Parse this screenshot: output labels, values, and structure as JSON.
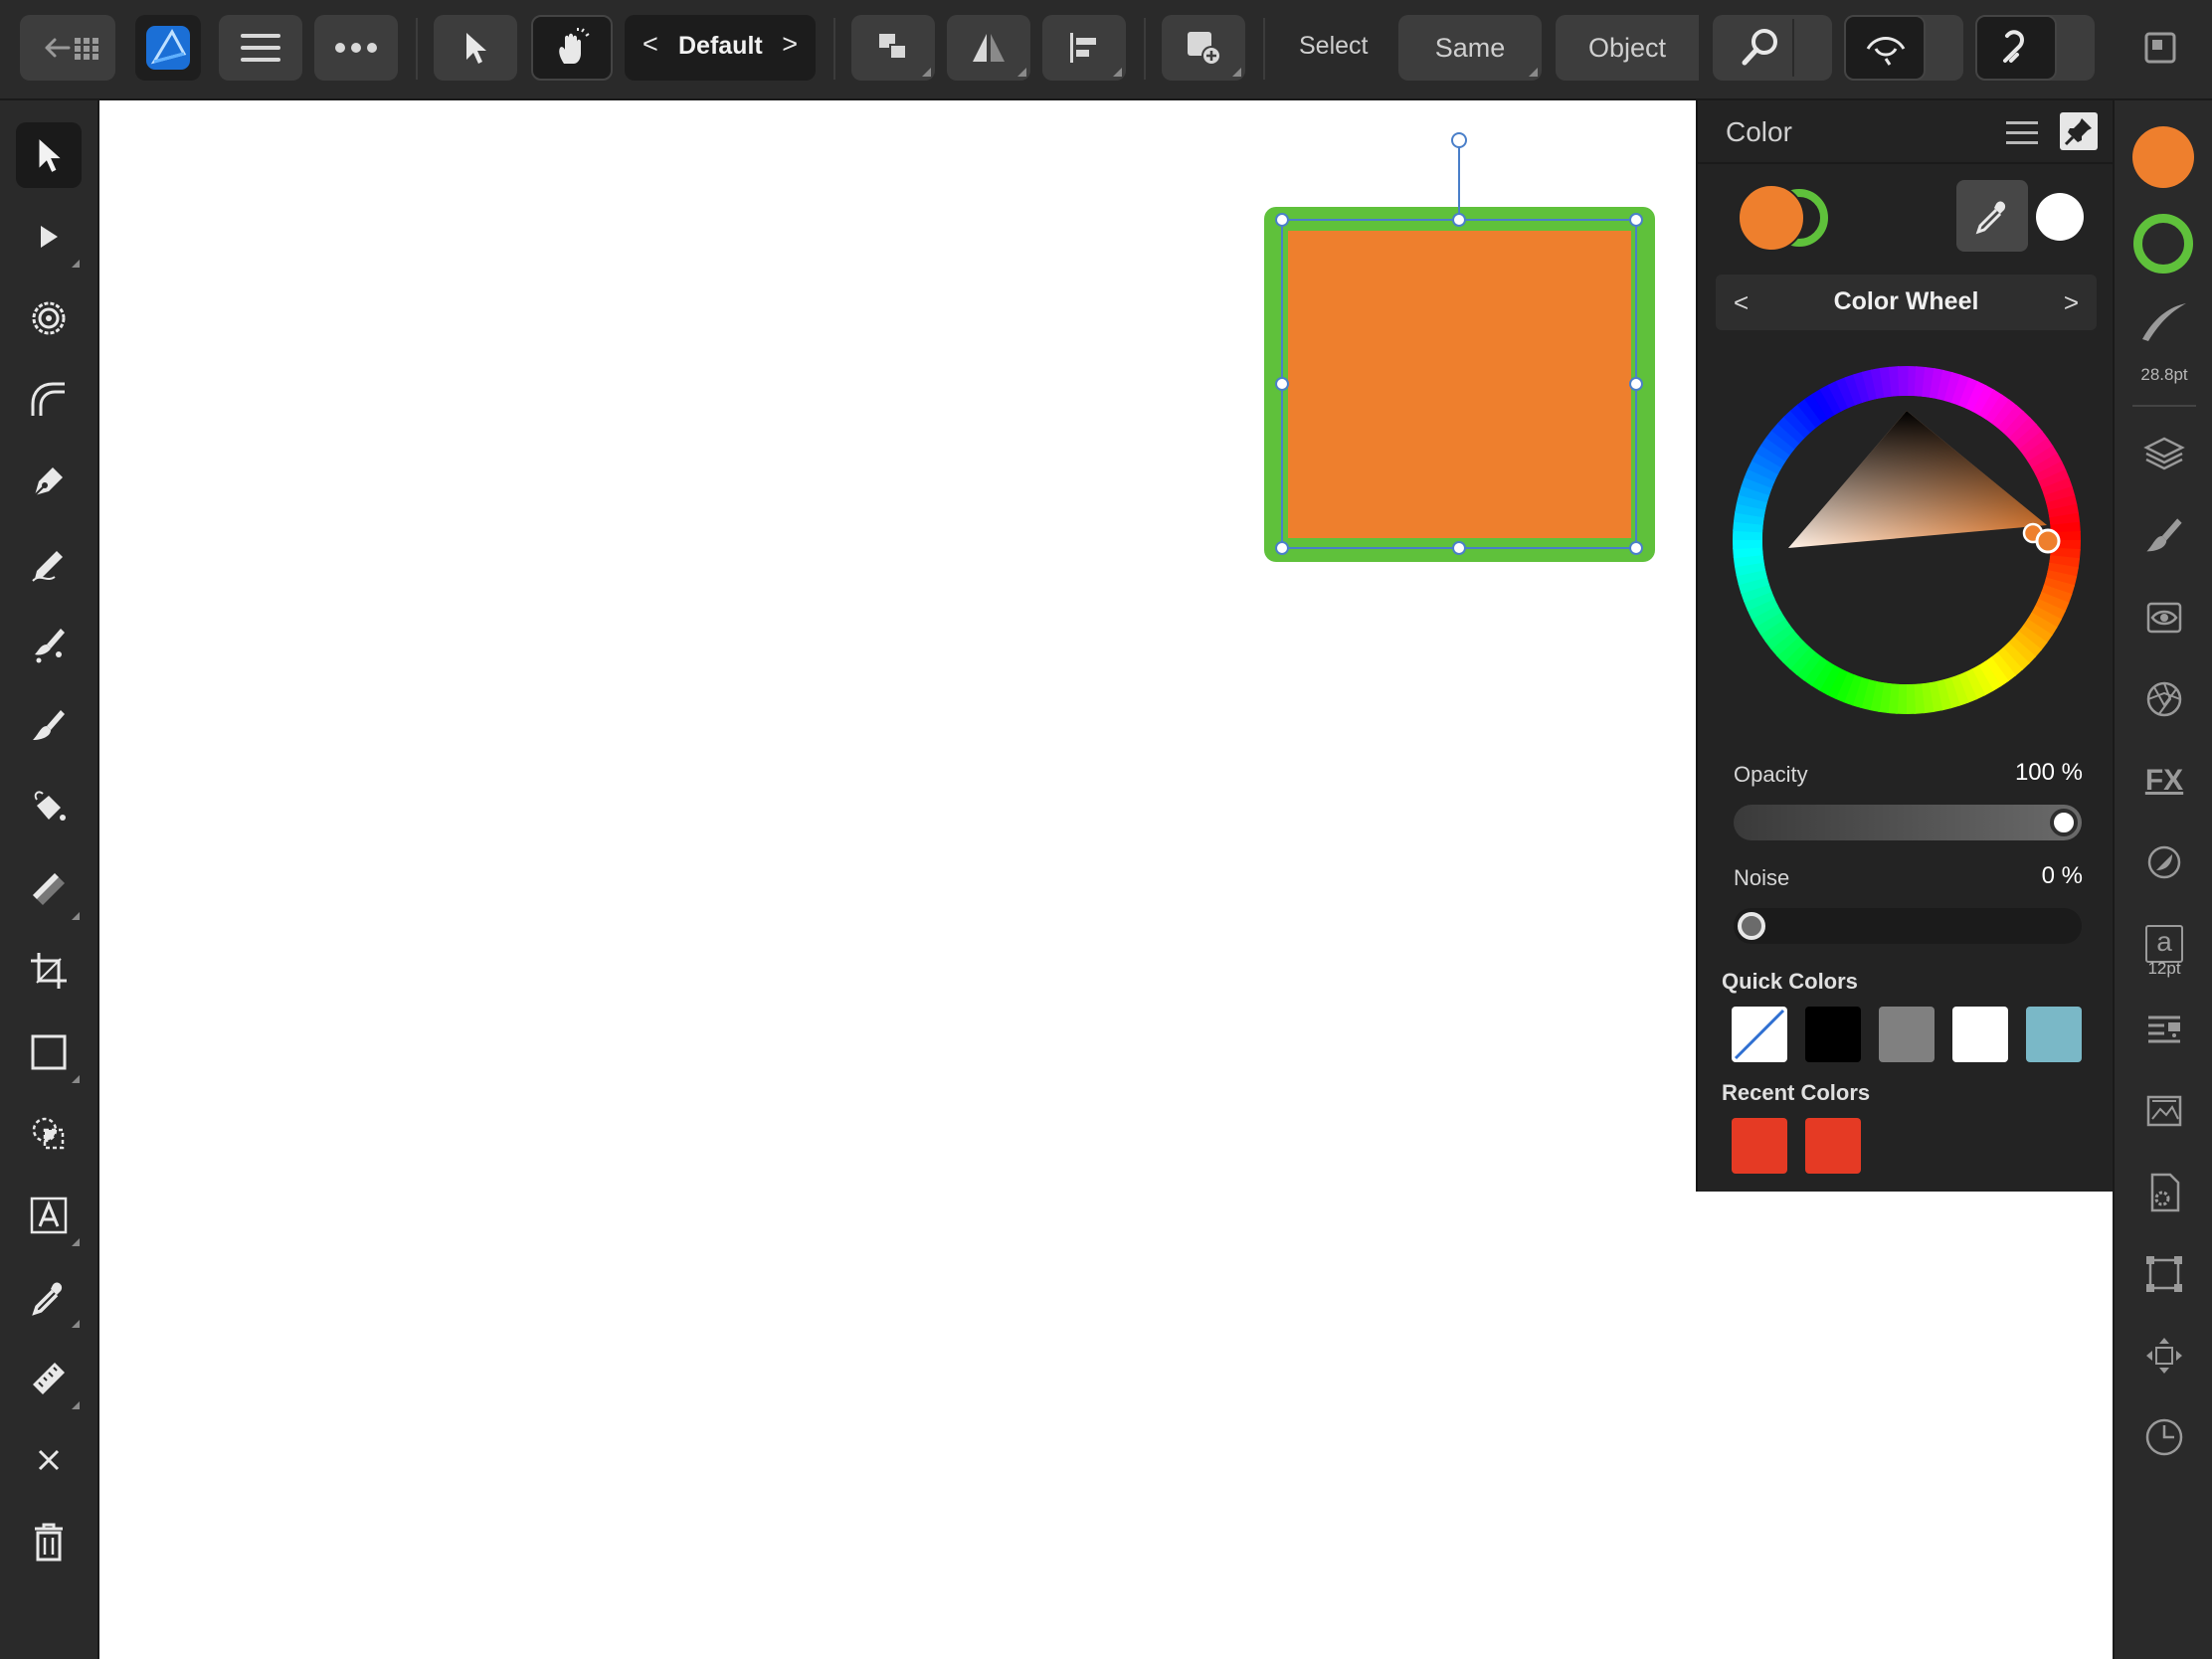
{
  "toolbar": {
    "back_icon": "back-arrow-grid-icon",
    "app_icon": "affinity-designer-logo",
    "menu_icon": "hamburger-icon",
    "more_icon": "more-dots-icon",
    "move_tool_icon": "arrow-cursor-icon",
    "touch_icon": "hand-touch-icon",
    "preset_prev": "<",
    "preset_label": "Default",
    "preset_next": ">",
    "arrange_icon": "arrange-icon",
    "flip_icon": "flip-icon",
    "align_icon": "align-icon",
    "add_shape_icon": "add-shape-icon",
    "select_label": "Select",
    "same_label": "Same",
    "object_label": "Object",
    "zoom_icon": "zoom-icon",
    "view_icon": "view-mode-icon",
    "snap_icon": "snapping-magnet-icon",
    "window_icon": "window-icon"
  },
  "left_tools": [
    {
      "name": "move-tool",
      "icon": "arrow-cursor-icon",
      "active": true
    },
    {
      "name": "node-tool",
      "icon": "node-arrow-icon"
    },
    {
      "name": "contour-tool",
      "icon": "contour-icon"
    },
    {
      "name": "corner-tool",
      "icon": "corner-icon"
    },
    {
      "name": "pen-tool",
      "icon": "pen-nib-icon"
    },
    {
      "name": "pencil-tool",
      "icon": "pencil-icon"
    },
    {
      "name": "vector-brush-tool",
      "icon": "vector-brush-icon"
    },
    {
      "name": "brush-tool",
      "icon": "paint-brush-icon"
    },
    {
      "name": "fill-tool",
      "icon": "fill-bucket-icon"
    },
    {
      "name": "transparency-tool",
      "icon": "transparency-icon"
    },
    {
      "name": "crop-tool",
      "icon": "crop-icon"
    },
    {
      "name": "rectangle-tool",
      "icon": "rectangle-icon"
    },
    {
      "name": "shape-builder-tool",
      "icon": "shape-builder-icon"
    },
    {
      "name": "artistic-text-tool",
      "icon": "text-frame-icon"
    },
    {
      "name": "color-picker-tool",
      "icon": "eyedropper-icon"
    },
    {
      "name": "measure-tool",
      "icon": "ruler-icon"
    },
    {
      "name": "close-tool",
      "icon": "close-icon"
    },
    {
      "name": "delete-tool",
      "icon": "trash-icon"
    }
  ],
  "right_studio": {
    "fill_color": "#ee7f2d",
    "stroke_color": "#5fc13b",
    "stroke_width_label": "28.8pt",
    "text_size_label": "12pt",
    "text_icon_letter": "a",
    "fx_label": "FX",
    "icons": [
      "layers-icon",
      "brushes-icon",
      "adjustments-icon",
      "effects-icon",
      "fx-icon",
      "styles-icon",
      "text-styles-icon",
      "paragraph-icon",
      "assets-icon",
      "document-settings-icon",
      "transform-icon",
      "move-icon",
      "history-icon"
    ]
  },
  "color_panel": {
    "title": "Color",
    "menu_icon": "hamburger-icon",
    "pin_icon": "pin-icon",
    "fill_color": "#ee7f2d",
    "stroke_color": "#5fc13b",
    "eyedropper_icon": "eyedropper-icon",
    "picked_color": "#ffffff",
    "mode_prev": "<",
    "mode_label": "Color Wheel",
    "mode_next": ">",
    "opacity_label": "Opacity",
    "opacity_value": "100 %",
    "opacity_fraction": 1.0,
    "noise_label": "Noise",
    "noise_value": "0 %",
    "noise_fraction": 0.0,
    "quick_colors_label": "Quick Colors",
    "quick_colors": [
      "none",
      "#000000",
      "#808080",
      "#ffffff",
      "#7ab8c7"
    ],
    "recent_colors_label": "Recent Colors",
    "recent_colors": [
      "#e53a24",
      "#e53a24"
    ]
  },
  "canvas": {
    "shape_fill": "#ee7f2d",
    "shape_stroke": "#5fc13b",
    "selection_color": "#4a7fc9"
  }
}
